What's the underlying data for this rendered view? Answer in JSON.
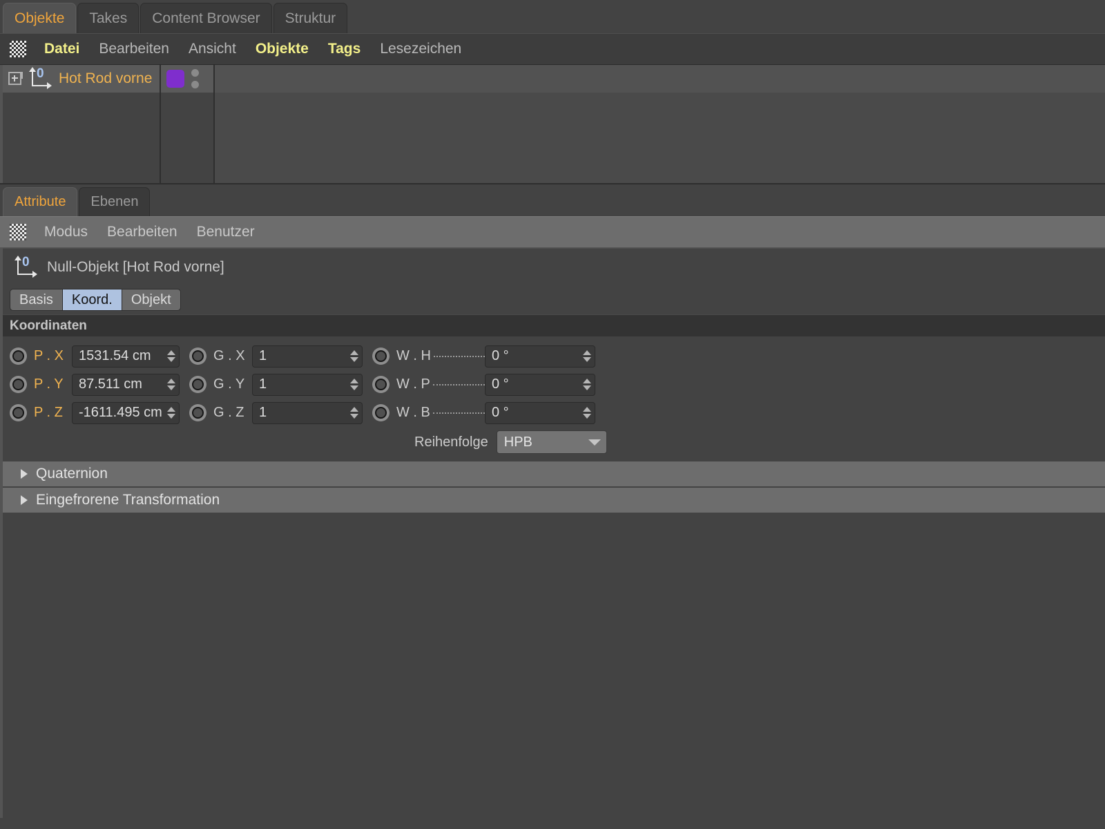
{
  "object_manager": {
    "tabs": [
      {
        "label": "Objekte",
        "active": true
      },
      {
        "label": "Takes",
        "active": false
      },
      {
        "label": "Content Browser",
        "active": false
      },
      {
        "label": "Struktur",
        "active": false
      }
    ],
    "menu": [
      {
        "label": "Datei",
        "highlight": true
      },
      {
        "label": "Bearbeiten",
        "highlight": false
      },
      {
        "label": "Ansicht",
        "highlight": false
      },
      {
        "label": "Objekte",
        "highlight": true
      },
      {
        "label": "Tags",
        "highlight": true
      },
      {
        "label": "Lesezeichen",
        "highlight": false
      }
    ],
    "grip_icon": "grip-dots-icon",
    "rows": [
      {
        "name": "Hot Rod vorne",
        "icon": "null-object-icon",
        "icon_badge": "0",
        "expander": "expand-plus-icon",
        "layer_color": "#7f2ecd",
        "visibility_dots": 2
      }
    ]
  },
  "attribute_manager": {
    "tabs": [
      {
        "label": "Attribute",
        "active": true
      },
      {
        "label": "Ebenen",
        "active": false
      }
    ],
    "menu": [
      {
        "label": "Modus"
      },
      {
        "label": "Bearbeiten"
      },
      {
        "label": "Benutzer"
      }
    ],
    "grip_icon": "grip-dots-icon",
    "object_header": {
      "icon": "null-object-icon",
      "icon_badge": "0",
      "title": "Null-Objekt [Hot Rod vorne]"
    },
    "subtabs": [
      {
        "label": "Basis",
        "active": false
      },
      {
        "label": "Koord.",
        "active": true
      },
      {
        "label": "Objekt",
        "active": false
      }
    ],
    "section_title": "Koordinaten",
    "coordinates": {
      "rows": [
        {
          "pos_label": "P . X",
          "pos_value": "1531.54 cm",
          "scale_label": "G . X",
          "scale_value": "1",
          "rot_label": "W . H",
          "rot_value": "0 °"
        },
        {
          "pos_label": "P . Y",
          "pos_value": "87.511 cm",
          "scale_label": "G . Y",
          "scale_value": "1",
          "rot_label": "W . P",
          "rot_value": "0 °"
        },
        {
          "pos_label": "P . Z",
          "pos_value": "-1611.495 cm",
          "scale_label": "G . Z",
          "scale_value": "1",
          "rot_label": "W . B",
          "rot_value": "0 °"
        }
      ],
      "order_label": "Reihenfolge",
      "order_value": "HPB"
    },
    "folds": [
      {
        "label": "Quaternion",
        "icon": "triangle-right-icon",
        "expanded": false
      },
      {
        "label": "Eingefrorene Transformation",
        "icon": "triangle-right-icon",
        "expanded": false
      }
    ]
  },
  "theme": {
    "accent_orange": "#f0a53c",
    "object_name_orange": "#f0b350",
    "menu_highlight_yellow": "#f3f08a",
    "active_subtab_blue": "#aec2e0",
    "layer_purple": "#7f2ecd",
    "panel_bg": "#434343"
  }
}
